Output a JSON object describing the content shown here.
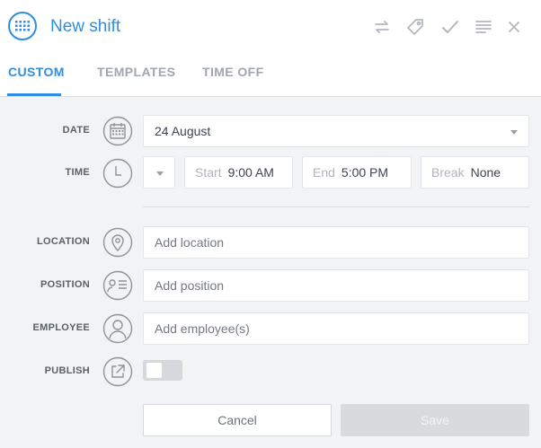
{
  "header": {
    "title": "New shift",
    "brand_color": "#2f8ee0",
    "actions": [
      "swap-icon",
      "tag-icon",
      "check-icon",
      "notes-icon",
      "close-icon"
    ]
  },
  "tabs": [
    {
      "label": "CUSTOM",
      "active": true
    },
    {
      "label": "TEMPLATES",
      "active": false
    },
    {
      "label": "TIME OFF",
      "active": false
    }
  ],
  "form": {
    "date": {
      "label": "DATE",
      "value": "24 August"
    },
    "time": {
      "label": "TIME",
      "start_label": "Start",
      "start_value": "9:00 AM",
      "end_label": "End",
      "end_value": "5:00 PM",
      "break_label": "Break",
      "break_value": "None"
    },
    "location": {
      "label": "LOCATION",
      "placeholder": "Add location"
    },
    "position": {
      "label": "POSITION",
      "placeholder": "Add position"
    },
    "employee": {
      "label": "EMPLOYEE",
      "placeholder": "Add employee(s)"
    },
    "publish": {
      "label": "PUBLISH",
      "enabled": false
    }
  },
  "buttons": {
    "cancel": "Cancel",
    "save": "Save"
  }
}
